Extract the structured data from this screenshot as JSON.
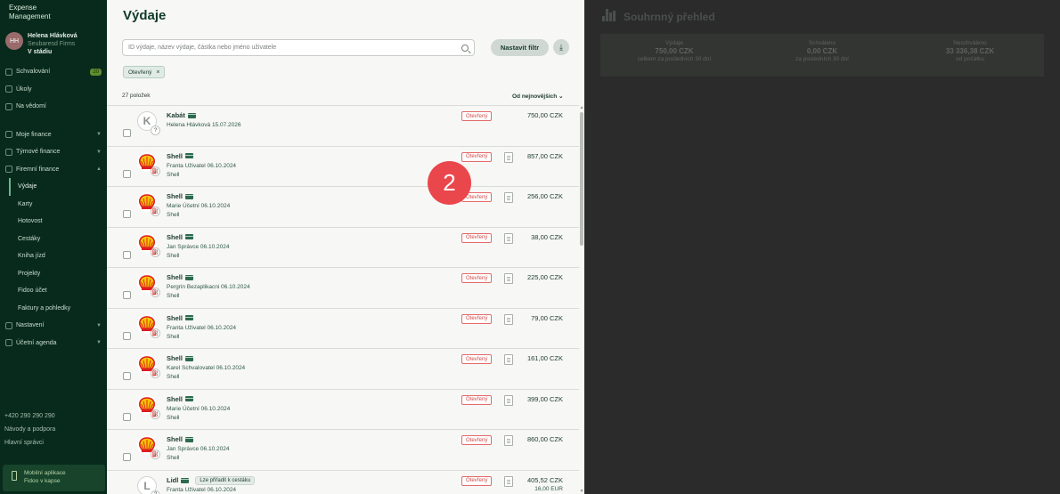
{
  "sidebar": {
    "brand_line1": "Expense",
    "brand_line2": "Management",
    "user": {
      "initials": "HH",
      "name": "Helena Hlávková",
      "role": "Seubaresd Firms",
      "status": "V stádiu"
    },
    "top_items": [
      {
        "label": "Schvalování",
        "badge": "20"
      },
      {
        "label": "Úkoly"
      },
      {
        "label": "Na vědomí"
      }
    ],
    "sections": [
      {
        "label": "Moje finance"
      },
      {
        "label": "Týmové finance"
      },
      {
        "label": "Firemní finance"
      }
    ],
    "sub_items": [
      "Výdaje",
      "Karty",
      "Hotovost",
      "Cestáky",
      "Kniha jízd",
      "Projekty",
      "Fidoo účet",
      "Faktury a pohledky"
    ],
    "bottom_sections": [
      {
        "label": "Nastavení"
      },
      {
        "label": "Účetní agenda"
      }
    ],
    "footer": [
      "+420 290 290 290",
      "Návody a podpora",
      "Hlavní správci"
    ],
    "mobile": {
      "line1": "Mobilní aplikace",
      "line2": "Fidoo v kapse"
    }
  },
  "main": {
    "title": "Výdaje",
    "search_placeholder": "ID výdaje, název výdaje, částka nebo jméno uživatele",
    "filter_button": "Nastavit filtr",
    "export_icon": "download-icon",
    "chip_label": "Otevřený",
    "chip_close": "×",
    "count": "27 položek",
    "sort_label": "Od nejnovějších",
    "step_number": "2",
    "rows": [
      {
        "merchant": "Kabát",
        "logo": "K",
        "line2": "Helena Hlávková 15.07.2026",
        "line3": "",
        "status": "Otevřený",
        "amount": "750,00 CZK",
        "amount2": "",
        "tag": "",
        "doc": false,
        "sub_icon": "?"
      },
      {
        "merchant": "Shell",
        "logo": "shell",
        "line2": "Franta Uživatel 06.10.2024",
        "line3": "Shell",
        "status": "Otevřený",
        "amount": "857,00 CZK",
        "amount2": "",
        "tag": "",
        "doc": true,
        "sub_icon": "⛽"
      },
      {
        "merchant": "Shell",
        "logo": "shell",
        "line2": "Marie Účetní 06.10.2024",
        "line3": "Shell",
        "status": "Otevřený",
        "amount": "256,00 CZK",
        "amount2": "",
        "tag": "",
        "doc": true,
        "sub_icon": "⛽"
      },
      {
        "merchant": "Shell",
        "logo": "shell",
        "line2": "Jan Správce 06.10.2024",
        "line3": "Shell",
        "status": "Otevřený",
        "amount": "38,00 CZK",
        "amount2": "",
        "tag": "",
        "doc": true,
        "sub_icon": "⛽"
      },
      {
        "merchant": "Shell",
        "logo": "shell",
        "line2": "Pergrin Bezaplikacni 06.10.2024",
        "line3": "Shell",
        "status": "Otevřený",
        "amount": "225,00 CZK",
        "amount2": "",
        "tag": "",
        "doc": true,
        "sub_icon": "⛽"
      },
      {
        "merchant": "Shell",
        "logo": "shell",
        "line2": "Franta Uživatel 06.10.2024",
        "line3": "Shell",
        "status": "Otevřený",
        "amount": "79,00 CZK",
        "amount2": "",
        "tag": "",
        "doc": true,
        "sub_icon": "⛽"
      },
      {
        "merchant": "Shell",
        "logo": "shell",
        "line2": "Karel Schvalovatel 06.10.2024",
        "line3": "Shell",
        "status": "Otevřený",
        "amount": "161,00 CZK",
        "amount2": "",
        "tag": "",
        "doc": true,
        "sub_icon": "⛽"
      },
      {
        "merchant": "Shell",
        "logo": "shell",
        "line2": "Marie Účetní 06.10.2024",
        "line3": "Shell",
        "status": "Otevřený",
        "amount": "399,00 CZK",
        "amount2": "",
        "tag": "",
        "doc": true,
        "sub_icon": "⛽"
      },
      {
        "merchant": "Shell",
        "logo": "shell",
        "line2": "Jan Správce 06.10.2024",
        "line3": "Shell",
        "status": "Otevřený",
        "amount": "860,00 CZK",
        "amount2": "",
        "tag": "",
        "doc": true,
        "sub_icon": "⛽"
      },
      {
        "merchant": "Lidl",
        "logo": "L",
        "line2": "Franta Uživatel 06.10.2024",
        "line3": "",
        "status": "Otevřený",
        "amount": "405,52 CZK",
        "amount2": "16,00 EUR",
        "tag": "Lze přiřadit k cestáku",
        "doc": true,
        "sub_icon": "?"
      }
    ]
  },
  "summary": {
    "title": "Souhrnný přehled",
    "stats": [
      {
        "label": "Výdaje",
        "value": "750,00 CZK",
        "note": "celkem za posledních 30 dní"
      },
      {
        "label": "Schváleno",
        "value": "0,00 CZK",
        "note": "za posledních 30 dní"
      },
      {
        "label": "Neschváleno",
        "value": "33 336,38 CZK",
        "note": "od počátku"
      }
    ]
  },
  "colors": {
    "sidebar_bg": "#072a1c",
    "panel_bg": "#f7f7f5",
    "accent": "#0f3a2c",
    "status_red": "#d34a4a",
    "step_badge": "#e9474c",
    "overlay": "#2a2a2a"
  }
}
